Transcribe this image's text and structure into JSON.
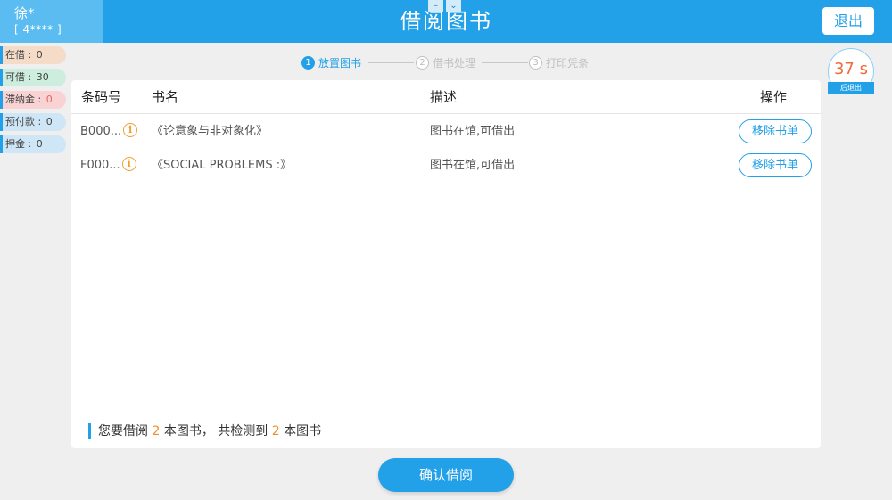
{
  "header": {
    "title": "借阅图书",
    "user_name": "徐*",
    "user_id": "[ 4**** ]",
    "exit_label": "退出",
    "window_controls": [
      "–",
      "⌄"
    ]
  },
  "stats": [
    {
      "label": "在借 : ",
      "value": "0",
      "bg": "#f5dcc8",
      "value_color": "#444444"
    },
    {
      "label": "可借 : ",
      "value": "30",
      "bg": "#cdeede",
      "value_color": "#444444"
    },
    {
      "label": "滞纳金 : ",
      "value": "0",
      "bg": "#f9d3d3",
      "value_color": "#f06060"
    },
    {
      "label": "预付款 : ",
      "value": "0",
      "bg": "#cfe6f6",
      "value_color": "#444444"
    },
    {
      "label": "押金 : ",
      "value": "0",
      "bg": "#cfe6f6",
      "value_color": "#444444"
    }
  ],
  "steps": [
    {
      "num": "1",
      "label": "放置图书",
      "active": true
    },
    {
      "num": "2",
      "label": "借书处理",
      "active": false
    },
    {
      "num": "3",
      "label": "打印凭条",
      "active": false
    }
  ],
  "countdown": {
    "seconds": "37 s",
    "label": "后退出"
  },
  "table": {
    "headers": {
      "barcode": "条码号",
      "title": "书名",
      "desc": "描述",
      "action": "操作"
    },
    "rows": [
      {
        "barcode": "B000...",
        "title": "《论意象与非对象化》",
        "desc": "图书在馆,可借出",
        "action": "移除书单"
      },
      {
        "barcode": "F000...",
        "title": "《SOCIAL PROBLEMS :》",
        "desc": "图书在馆,可借出",
        "action": "移除书单"
      }
    ]
  },
  "summary": {
    "p1": "您要借阅 ",
    "n1": "2",
    "p2": " 本图书， 共检测到 ",
    "n2": "2",
    "p3": " 本图书"
  },
  "confirm_label": "确认借阅",
  "colors": {
    "accent": "#22a0e8",
    "warning": "#f0902a",
    "countdown": "#f06a3a"
  }
}
